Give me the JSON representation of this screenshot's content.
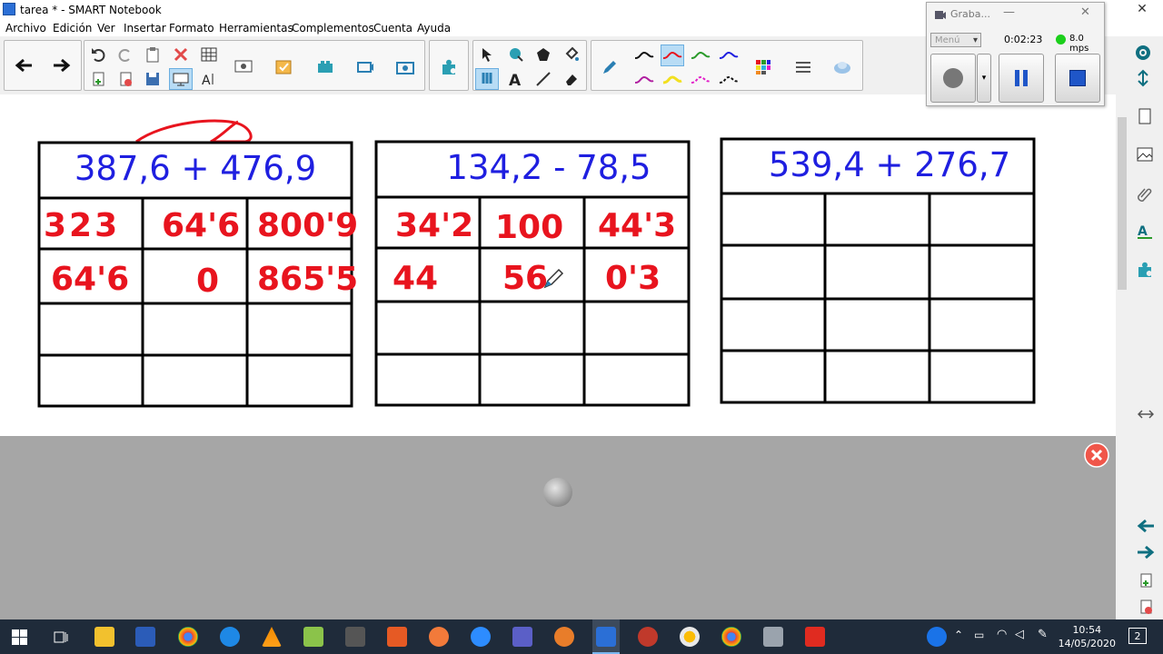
{
  "window": {
    "title": "tarea * - SMART Notebook"
  },
  "menu": [
    "Archivo",
    "Edición",
    "Ver",
    "Insertar",
    "Formato",
    "Herramientas",
    "Complementos",
    "Cuenta",
    "Ayuda"
  ],
  "recorder": {
    "title": "Graba...",
    "menu_label": "Menú",
    "time": "0:02:23",
    "rate": "8.0 mps"
  },
  "tables": [
    {
      "header": "387,6 + 476,9",
      "rows": [
        [
          "323",
          "64'6",
          "800'9"
        ],
        [
          "64'6",
          "0",
          "865'5"
        ],
        [
          "",
          "",
          ""
        ],
        [
          "",
          "",
          ""
        ]
      ]
    },
    {
      "header": "134,2 - 78,5",
      "rows": [
        [
          "34'2",
          "100",
          "44'3"
        ],
        [
          "44",
          "56",
          "0'3"
        ],
        [
          "",
          "",
          ""
        ],
        [
          "",
          "",
          ""
        ]
      ]
    },
    {
      "header": "539,4 + 276,7",
      "rows": [
        [
          "",
          "",
          ""
        ],
        [
          "",
          "",
          ""
        ],
        [
          "",
          "",
          ""
        ],
        [
          "",
          "",
          ""
        ]
      ]
    }
  ],
  "taskbar": {
    "time": "10:54",
    "date": "14/05/2020",
    "notifications": "2"
  },
  "colors": {
    "header_text": "#1f1fe0",
    "ink": "#e8141e",
    "grid": "#000000"
  }
}
